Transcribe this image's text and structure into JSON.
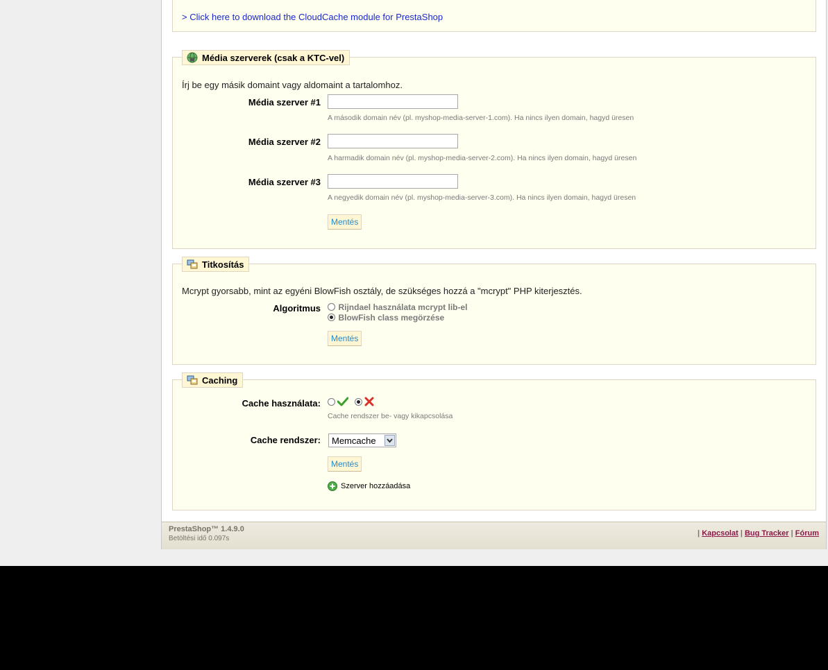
{
  "cloudcache": {
    "link_text": "> Click here to download the CloudCache module for PrestaShop"
  },
  "media": {
    "legend": "Média szerverek (csak a KTC-vel)",
    "intro": "Írj be egy másik domaint vagy aldomaint a tartalomhoz.",
    "servers": [
      {
        "label": "Média szerver #1",
        "value": "",
        "hint": "A második domain név (pl. myshop-media-server-1.com). Ha nincs ilyen domain, hagyd üresen"
      },
      {
        "label": "Média szerver #2",
        "value": "",
        "hint": "A harmadik domain név (pl. myshop-media-server-2.com). Ha nincs ilyen domain, hagyd üresen"
      },
      {
        "label": "Média szerver #3",
        "value": "",
        "hint": "A negyedik domain név (pl. myshop-media-server-3.com). Ha nincs ilyen domain, hagyd üresen"
      }
    ],
    "save_label": "Mentés"
  },
  "crypto": {
    "legend": "Titkosítás",
    "intro": "Mcrypt gyorsabb, mint az egyéni BlowFish osztály, de szükséges hozzá a \"mcrypt\" PHP kiterjesztés.",
    "algorithm_label": "Algoritmus",
    "options": [
      {
        "label": "Rijndael használata mcrypt lib-el",
        "checked": false
      },
      {
        "label": "BlowFish class megörzése",
        "checked": true
      }
    ],
    "save_label": "Mentés"
  },
  "caching": {
    "legend": "Caching",
    "use_cache_label": "Cache használata:",
    "use_cache_enabled": false,
    "use_cache_hint": "Cache rendszer be- vagy kikapcsolása",
    "system_label": "Cache rendszer:",
    "system_selected": "Memcache",
    "save_label": "Mentés",
    "add_server_label": "Szerver hozzáadása"
  },
  "footer": {
    "version": "PrestaShop™ 1.4.9.0",
    "load_time": "Betöltési idő 0.097s",
    "links": [
      "Kapcsolat",
      "Bug Tracker",
      "Fórum"
    ],
    "separator": "|"
  },
  "colors": {
    "panel_bg": "#fffff0",
    "legend_bg": "#fff6d3",
    "link_blue": "#1a28c9",
    "button_text": "#268ccd",
    "footer_link": "#8b1a4a",
    "check_green": "#3ca02c",
    "cross_red": "#d9302a"
  }
}
